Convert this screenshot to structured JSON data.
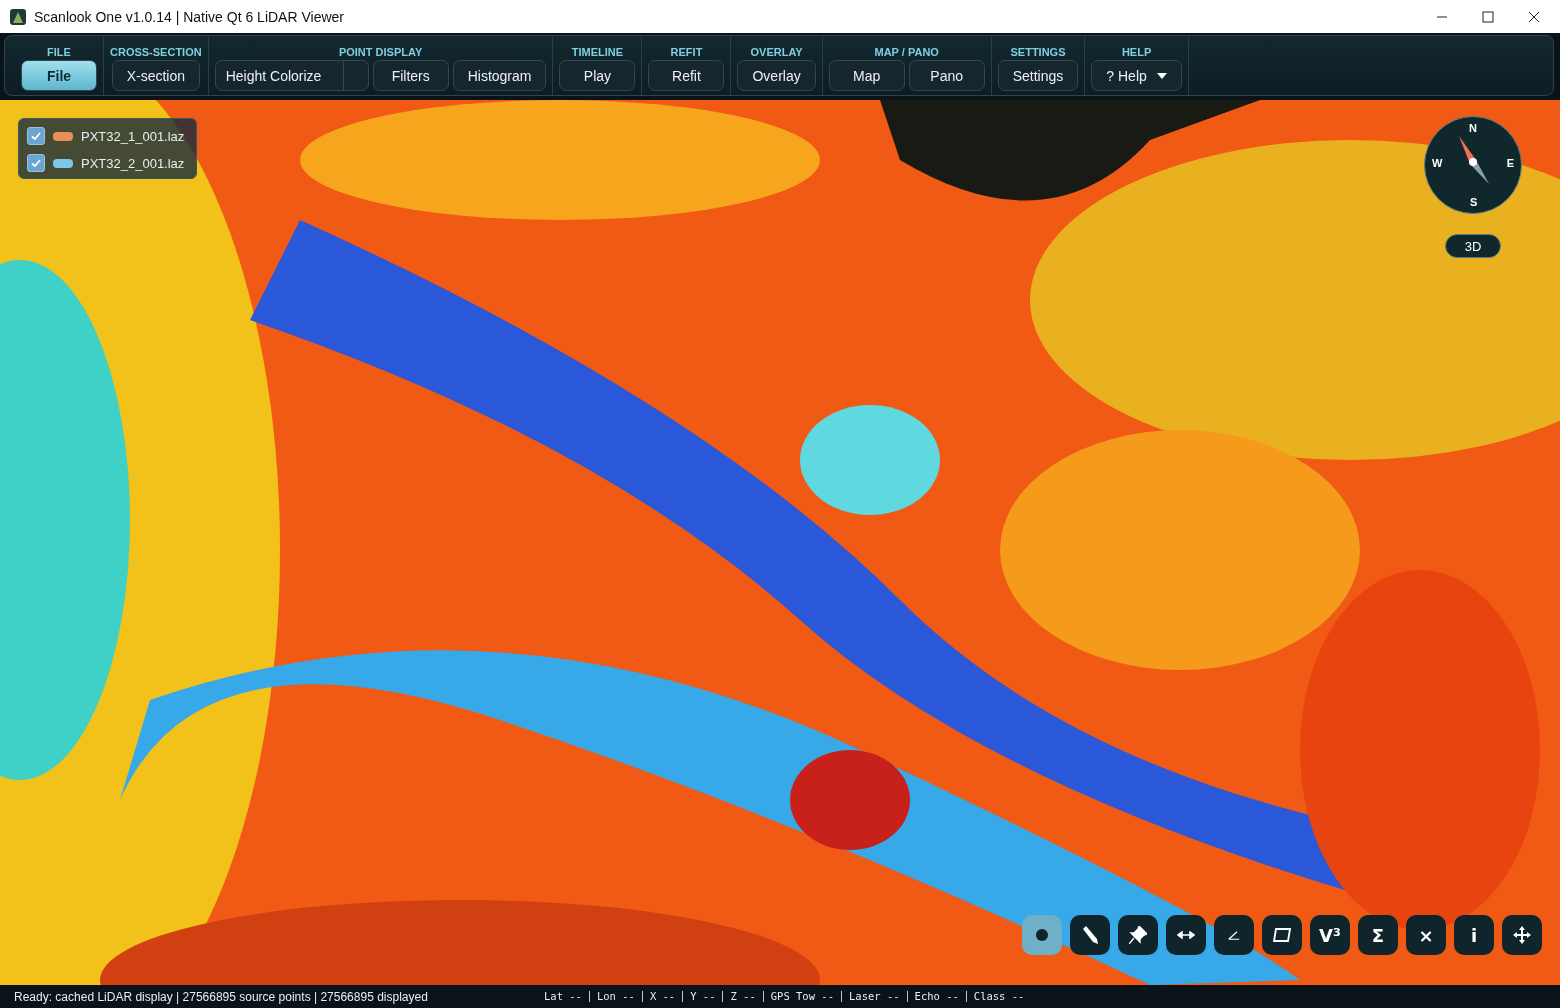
{
  "window": {
    "title": "Scanlook One v1.0.14 | Native Qt 6 LiDAR Viewer"
  },
  "toolbar": {
    "groups": [
      {
        "label": "FILE",
        "controls": [
          {
            "kind": "button",
            "label": "File",
            "selected": true
          }
        ]
      },
      {
        "label": "CROSS-SECTION",
        "controls": [
          {
            "kind": "button",
            "label": "X-section",
            "selected": false
          }
        ]
      },
      {
        "label": "POINT DISPLAY",
        "controls": [
          {
            "kind": "combo",
            "label": "Height Colorize",
            "selected": false
          },
          {
            "kind": "button",
            "label": "Filters",
            "selected": false
          },
          {
            "kind": "button",
            "label": "Histogram",
            "selected": false
          }
        ]
      },
      {
        "label": "TIMELINE",
        "controls": [
          {
            "kind": "button",
            "label": "Play",
            "selected": false
          }
        ]
      },
      {
        "label": "REFIT",
        "controls": [
          {
            "kind": "button",
            "label": "Refit",
            "selected": false
          }
        ]
      },
      {
        "label": "OVERLAY",
        "controls": [
          {
            "kind": "button",
            "label": "Overlay",
            "selected": false
          }
        ]
      },
      {
        "label": "MAP / PANO",
        "controls": [
          {
            "kind": "button",
            "label": "Map",
            "selected": false
          },
          {
            "kind": "button",
            "label": "Pano",
            "selected": false
          }
        ]
      },
      {
        "label": "SETTINGS",
        "controls": [
          {
            "kind": "button",
            "label": "Settings",
            "selected": false
          }
        ]
      },
      {
        "label": "HELP",
        "controls": [
          {
            "kind": "menu",
            "label": "?  Help",
            "selected": false
          }
        ]
      }
    ]
  },
  "layers": [
    {
      "name": "PXT32_1_001.laz",
      "checked": true,
      "color": "#e8905a"
    },
    {
      "name": "PXT32_2_001.laz",
      "checked": true,
      "color": "#7cc8e8"
    }
  ],
  "compass": {
    "north": "N",
    "west": "W",
    "east": "E",
    "south": "S"
  },
  "view_button": "3D",
  "tools": [
    {
      "kind": "icon",
      "selected": true
    },
    {
      "kind": "icon",
      "selected": false
    },
    {
      "kind": "icon",
      "selected": false
    },
    {
      "kind": "icon",
      "selected": false
    },
    {
      "kind": "icon",
      "selected": false
    },
    {
      "kind": "icon",
      "selected": false
    },
    {
      "kind": "glyph",
      "label": "V³",
      "selected": false
    },
    {
      "kind": "glyph",
      "label": "Σ",
      "selected": false
    },
    {
      "kind": "glyph",
      "label": "×",
      "selected": false
    },
    {
      "kind": "glyph",
      "label": "i",
      "selected": false
    },
    {
      "kind": "icon",
      "selected": false
    }
  ],
  "status_bar": {
    "message": "Ready: cached LiDAR display | 27566895 source points | 27566895 displayed",
    "fields": [
      "Lat --",
      "Lon --",
      "X --",
      "Y --",
      "Z --",
      "GPS Tow --",
      "Laser --",
      "Echo --",
      "Class --"
    ]
  }
}
